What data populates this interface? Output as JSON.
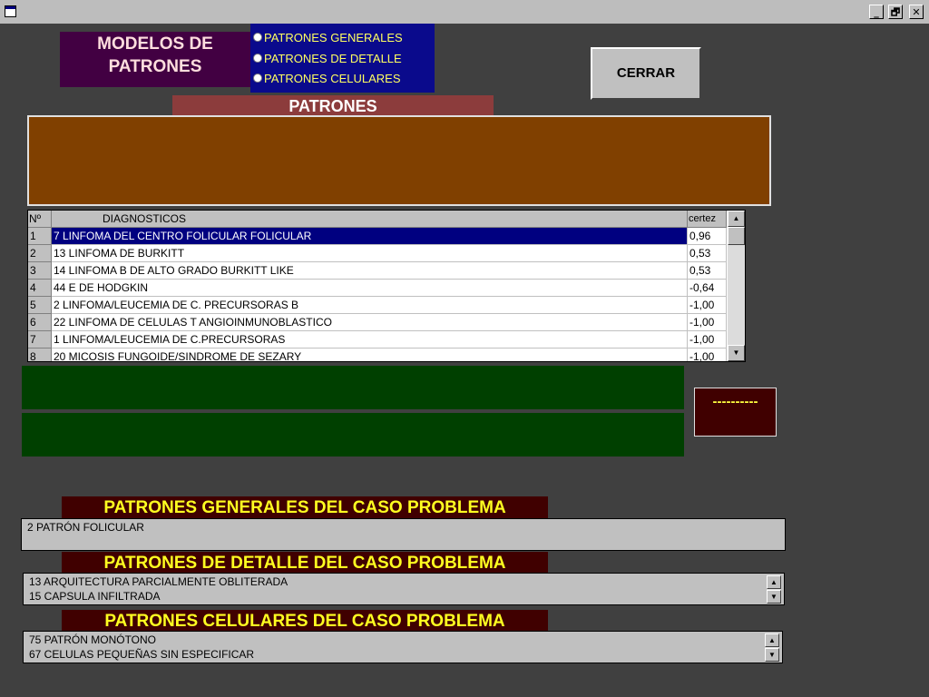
{
  "window": {
    "controls": [
      "_",
      "🗗",
      "✕"
    ]
  },
  "title_label": [
    "MODELOS DE",
    "PATRONES"
  ],
  "radios": [
    {
      "label": "PATRONES GENERALES"
    },
    {
      "label": "PATRONES DE DETALLE"
    },
    {
      "label": "PATRONES CELULARES"
    }
  ],
  "close_button": "CERRAR",
  "patrones_header": "PATRONES",
  "grid": {
    "headers": [
      "Nº",
      "DIAGNOSTICOS",
      "certez"
    ],
    "rows": [
      {
        "n": "1",
        "diag": "7 LINFOMA DEL CENTRO FOLICULAR FOLICULAR",
        "cert": "0,96"
      },
      {
        "n": "2",
        "diag": "13 LINFOMA DE BURKITT",
        "cert": "0,53"
      },
      {
        "n": "3",
        "diag": "14 LINFOMA B DE ALTO GRADO BURKITT LIKE",
        "cert": "0,53"
      },
      {
        "n": "4",
        "diag": "44 E DE HODGKIN",
        "cert": "-0,64"
      },
      {
        "n": "5",
        "diag": "2 LINFOMA/LEUCEMIA DE C. PRECURSORAS B",
        "cert": "-1,00"
      },
      {
        "n": "6",
        "diag": "22 LINFOMA DE CELULAS T ANGIOINMUNOBLASTICO",
        "cert": "-1,00"
      },
      {
        "n": "7",
        "diag": "1 LINFOMA/LEUCEMIA DE C.PRECURSORAS",
        "cert": "-1,00"
      },
      {
        "n": "8",
        "diag": "20 MICOSIS FUNGOIDE/SINDROME DE SEZARY",
        "cert": "-1,00"
      }
    ]
  },
  "dash_box": "----------",
  "sections": {
    "generales": {
      "title": "PATRONES GENERALES DEL CASO PROBLEMA",
      "lines": [
        "2 PATRÓN FOLICULAR"
      ]
    },
    "detalle": {
      "title": "PATRONES DE DETALLE DEL CASO PROBLEMA",
      "lines": [
        "13 ARQUITECTURA PARCIALMENTE OBLITERADA",
        "15 CAPSULA INFILTRADA"
      ]
    },
    "celulares": {
      "title": "PATRONES CELULARES DEL CASO PROBLEMA",
      "lines": [
        "75 PATRÓN MONÓTONO",
        "67 CELULAS PEQUEÑAS SIN ESPECIFICAR"
      ]
    }
  }
}
